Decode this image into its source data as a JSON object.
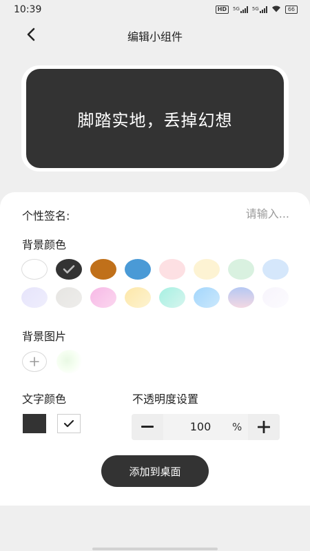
{
  "status_bar": {
    "time": "10:39",
    "hd": "HD",
    "net1": "5G",
    "net2": "5G",
    "battery": "66"
  },
  "header": {
    "title": "编辑小组件"
  },
  "preview": {
    "text": "脚踏实地，丢掉幻想",
    "bg_color": "#333333",
    "text_color": "#ffffff"
  },
  "signature": {
    "label": "个性签名:",
    "placeholder": "请输入...",
    "value": ""
  },
  "background_color": {
    "label": "背景颜色",
    "selected_index": 1,
    "swatches": [
      "#ffffff",
      "#333333",
      "#c0701a",
      "#4a9ad6",
      "#fde0e3",
      "#fdf3d3",
      "#d9f1e0",
      "#d5e7fb",
      "linear-gradient(135deg,#e6e4fb,#efeefc)",
      "linear-gradient(135deg,#e6e5e2,#eeedeb)",
      "linear-gradient(135deg,#f7b8e6,#fbd7ef)",
      "linear-gradient(135deg,#fde7a8,#fdf3d1)",
      "linear-gradient(135deg,#a6f0e2,#d6f5ee)",
      "linear-gradient(135deg,#a3d6fb,#cbe8fd)",
      "linear-gradient(180deg,#b6c8f3,#f3d8e3)",
      "linear-gradient(135deg,#f7f4fc,#fcfbfe)"
    ]
  },
  "background_image": {
    "label": "背景图片"
  },
  "text_color": {
    "label": "文字颜色",
    "options": [
      "#333333",
      "#ffffff"
    ],
    "selected_index": 1
  },
  "opacity": {
    "label": "不透明度设置",
    "value": "100",
    "unit": "%"
  },
  "add_button": {
    "label": "添加到桌面"
  }
}
